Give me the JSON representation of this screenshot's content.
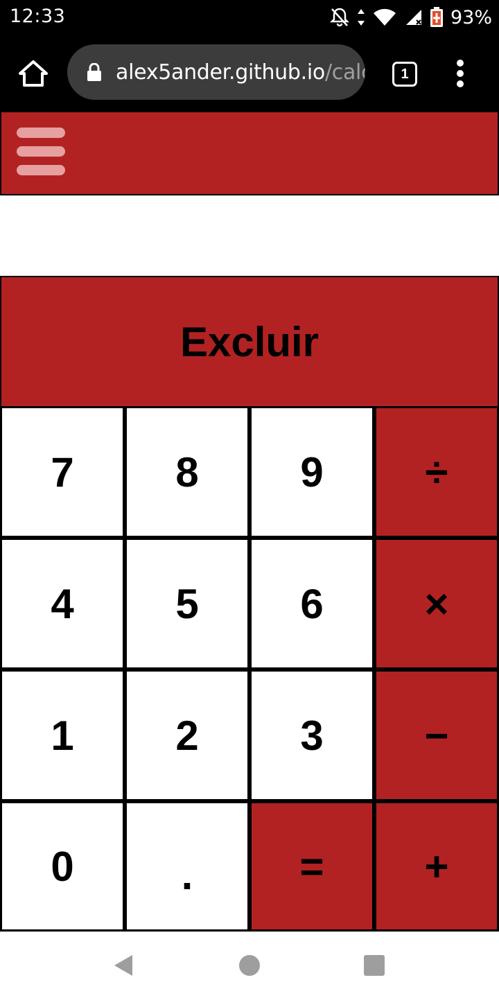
{
  "status_bar": {
    "time": "12:33",
    "battery_percent": "93%",
    "icons": [
      "notifications-off-icon",
      "data-arrows-icon",
      "wifi-icon",
      "cell-signal-icon",
      "battery-charging-icon"
    ]
  },
  "browser": {
    "url_host": "alex5ander.github.io",
    "url_path": "/calc",
    "tab_count": "1",
    "icons": [
      "home-icon",
      "lock-icon",
      "tabs-icon",
      "more-vert-icon"
    ]
  },
  "app": {
    "header_color": "#b22222",
    "menu_icon": "hamburger-icon",
    "display_value": "",
    "clear_label": "Excluir",
    "keys": [
      {
        "label": "7",
        "type": "digit"
      },
      {
        "label": "8",
        "type": "digit"
      },
      {
        "label": "9",
        "type": "digit"
      },
      {
        "label": "÷",
        "type": "operator"
      },
      {
        "label": "4",
        "type": "digit"
      },
      {
        "label": "5",
        "type": "digit"
      },
      {
        "label": "6",
        "type": "digit"
      },
      {
        "label": "×",
        "type": "operator"
      },
      {
        "label": "1",
        "type": "digit"
      },
      {
        "label": "2",
        "type": "digit"
      },
      {
        "label": "3",
        "type": "digit"
      },
      {
        "label": "−",
        "type": "operator"
      },
      {
        "label": "0",
        "type": "digit"
      },
      {
        "label": ".",
        "type": "digit"
      },
      {
        "label": "=",
        "type": "operator"
      },
      {
        "label": "+",
        "type": "operator"
      }
    ]
  },
  "nav_bar": {
    "icons": [
      "back-icon",
      "home-icon",
      "recents-icon"
    ]
  }
}
